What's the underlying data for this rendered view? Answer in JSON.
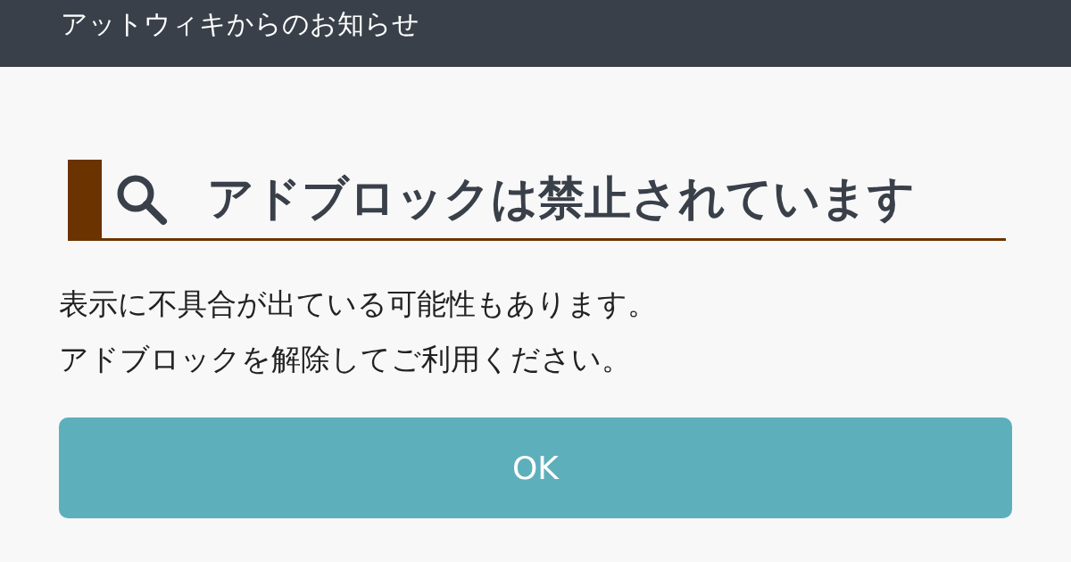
{
  "header": {
    "title": "アットウィキからのお知らせ"
  },
  "heading": {
    "text": "アドブロックは禁止されています"
  },
  "message": [
    "表示に不具合が出ている可能性もあります。",
    "アドブロックを解除してご利用ください。"
  ],
  "button": {
    "label": "OK"
  }
}
